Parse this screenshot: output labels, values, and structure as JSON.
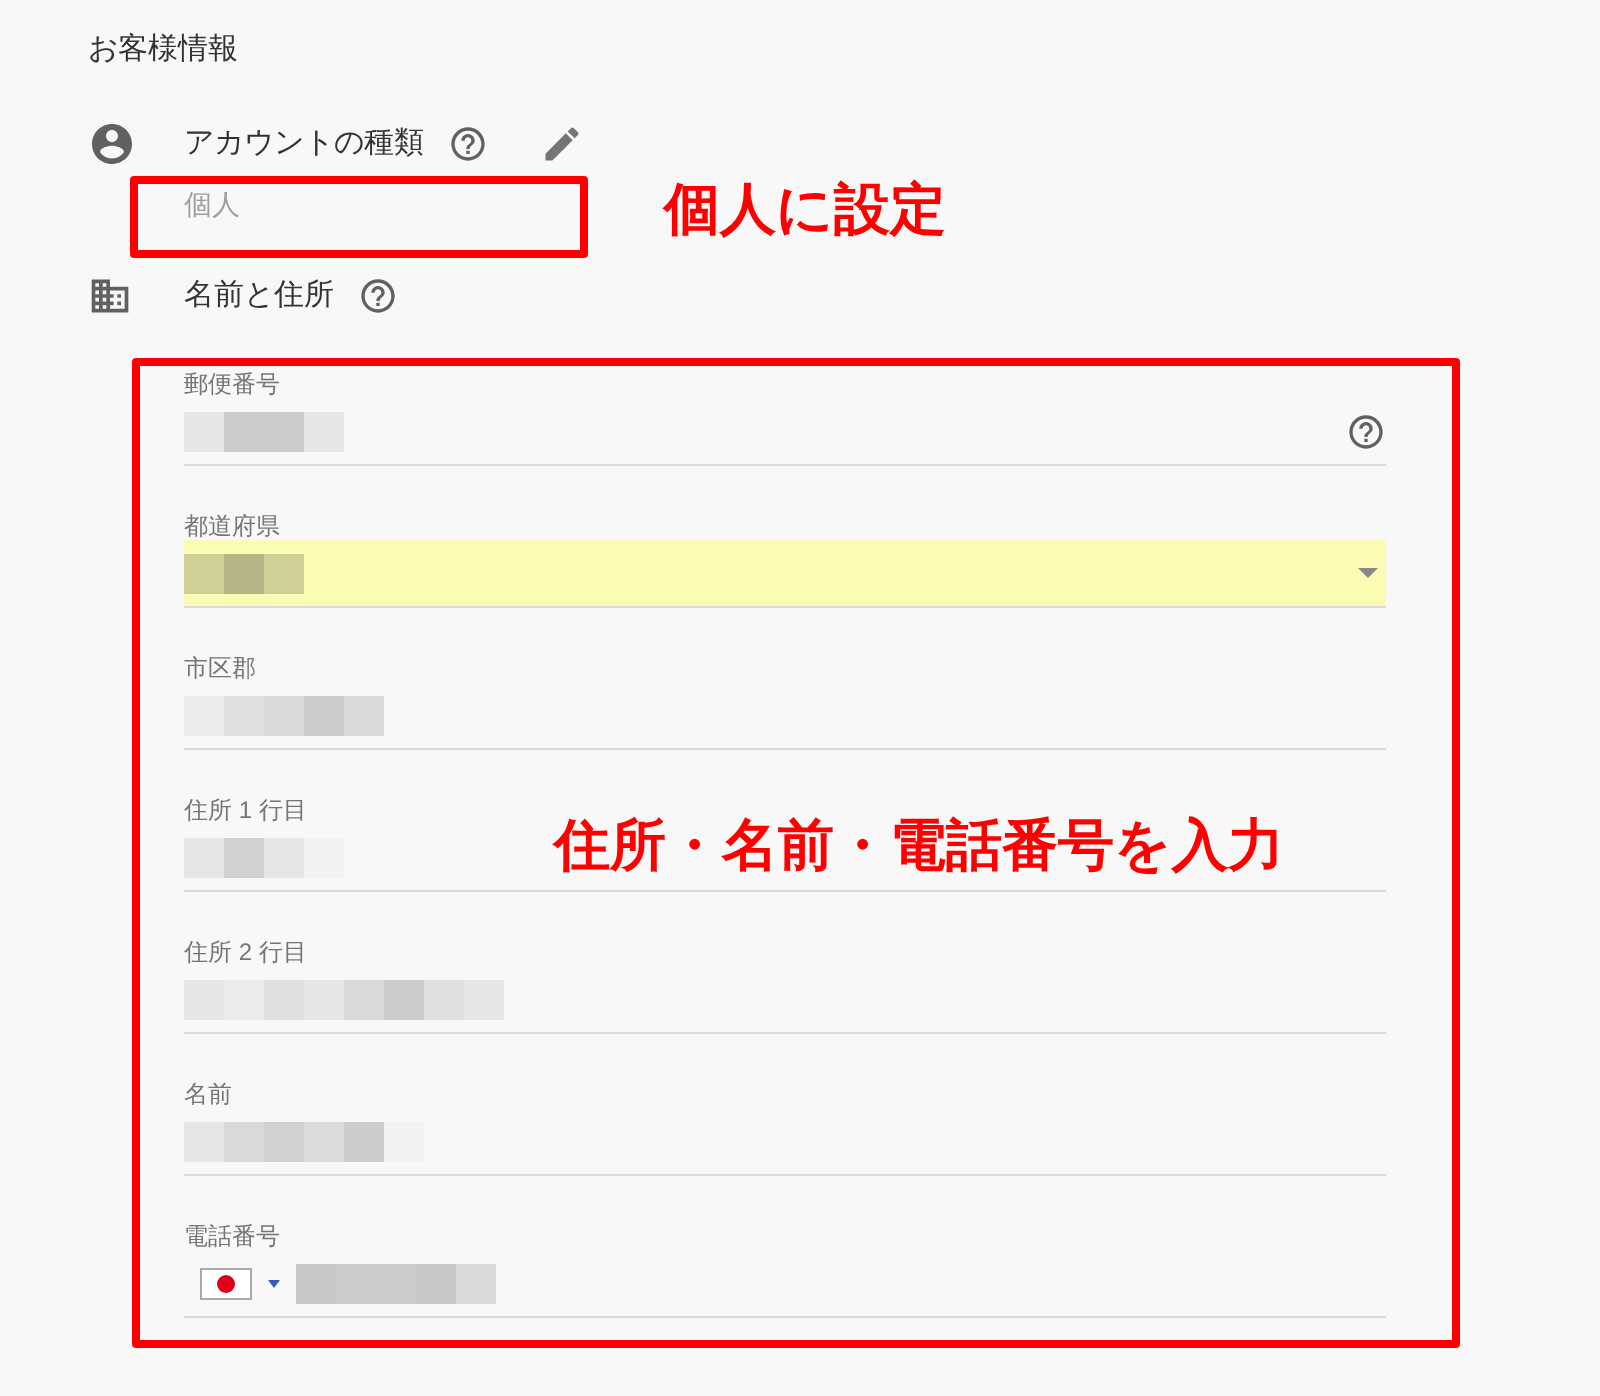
{
  "heading": "お客様情報",
  "account_type": {
    "label": "アカウントの種類",
    "value": "個人"
  },
  "name_address": {
    "label": "名前と住所"
  },
  "fields": [
    {
      "kind": "help",
      "label": "郵便番号"
    },
    {
      "kind": "select",
      "label": "都道府県",
      "autofilled": true
    },
    {
      "kind": "text",
      "label": "市区郡"
    },
    {
      "kind": "text",
      "label": "住所 1 行目"
    },
    {
      "kind": "text",
      "label": "住所 2 行目"
    },
    {
      "kind": "text",
      "label": "名前"
    },
    {
      "kind": "phone",
      "label": "電話番号"
    }
  ],
  "annotations": [
    {
      "text": "個人に設定"
    },
    {
      "text": "住所・名前・電話番号を入力"
    }
  ]
}
